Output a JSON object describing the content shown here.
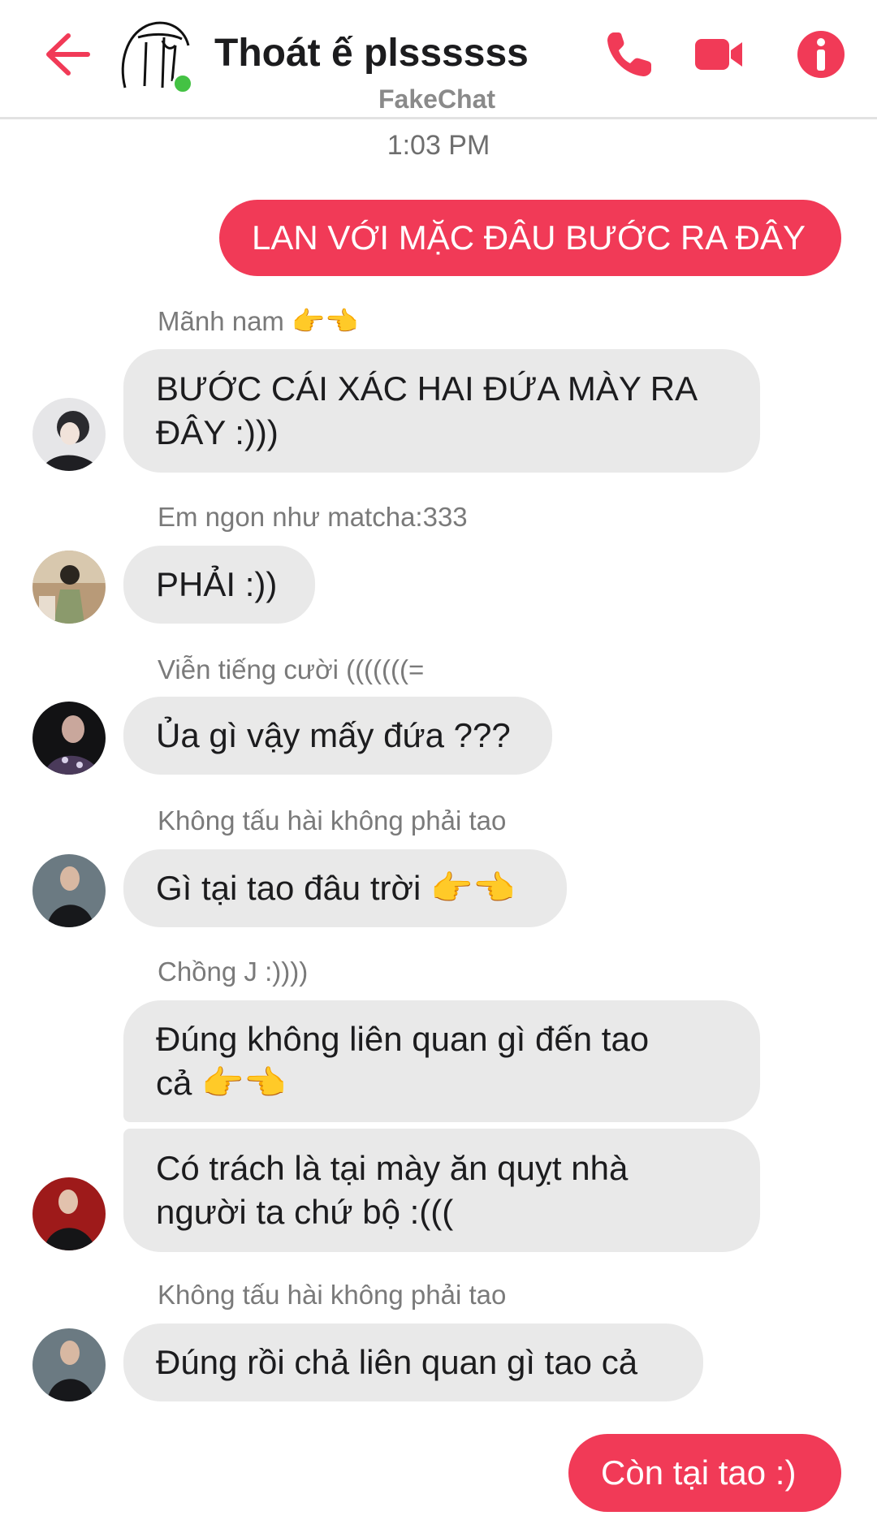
{
  "header": {
    "title": "Thoát ế plssssss",
    "subtitle": "FakeChat",
    "accent_color": "#f13a57",
    "online_color": "#44c244",
    "icons": [
      "back-arrow-icon",
      "phone-icon",
      "video-camera-icon",
      "info-icon"
    ]
  },
  "timestamp": "1:03 PM",
  "messages": [
    {
      "text": "LAN VỚI MẶC ĐÂU BƯỚC RA ĐÂY"
    },
    {
      "sender": "Mãnh nam",
      "sender_emoji": "👉👈"
    },
    {
      "text": "BƯỚC CÁI XÁC HAI ĐỨA MÀY RA ĐÂY :)))"
    },
    {
      "sender": "Em ngon như matcha:333"
    },
    {
      "text": "PHẢI :))"
    },
    {
      "sender": "Viễn tiếng cười (((((((="
    },
    {
      "text": "Ủa gì vậy mấy đứa ???"
    },
    {
      "sender": "Không tấu hài không phải tao"
    },
    {
      "text": "Gì tại tao đâu trời",
      "emoji": "👉👈"
    },
    {
      "sender": "Chồng J :))))"
    },
    {
      "text": "Đúng không liên quan gì đến tao cả",
      "emoji": "👉👈"
    },
    {
      "text": "Có trách là tại mày ăn quỵt nhà người ta chứ bộ :((("
    },
    {
      "sender": "Không tấu hài không phải tao"
    },
    {
      "text": "Đúng rồi chả liên quan gì tao cả"
    },
    {
      "text": "Còn tại tao :)"
    }
  ]
}
